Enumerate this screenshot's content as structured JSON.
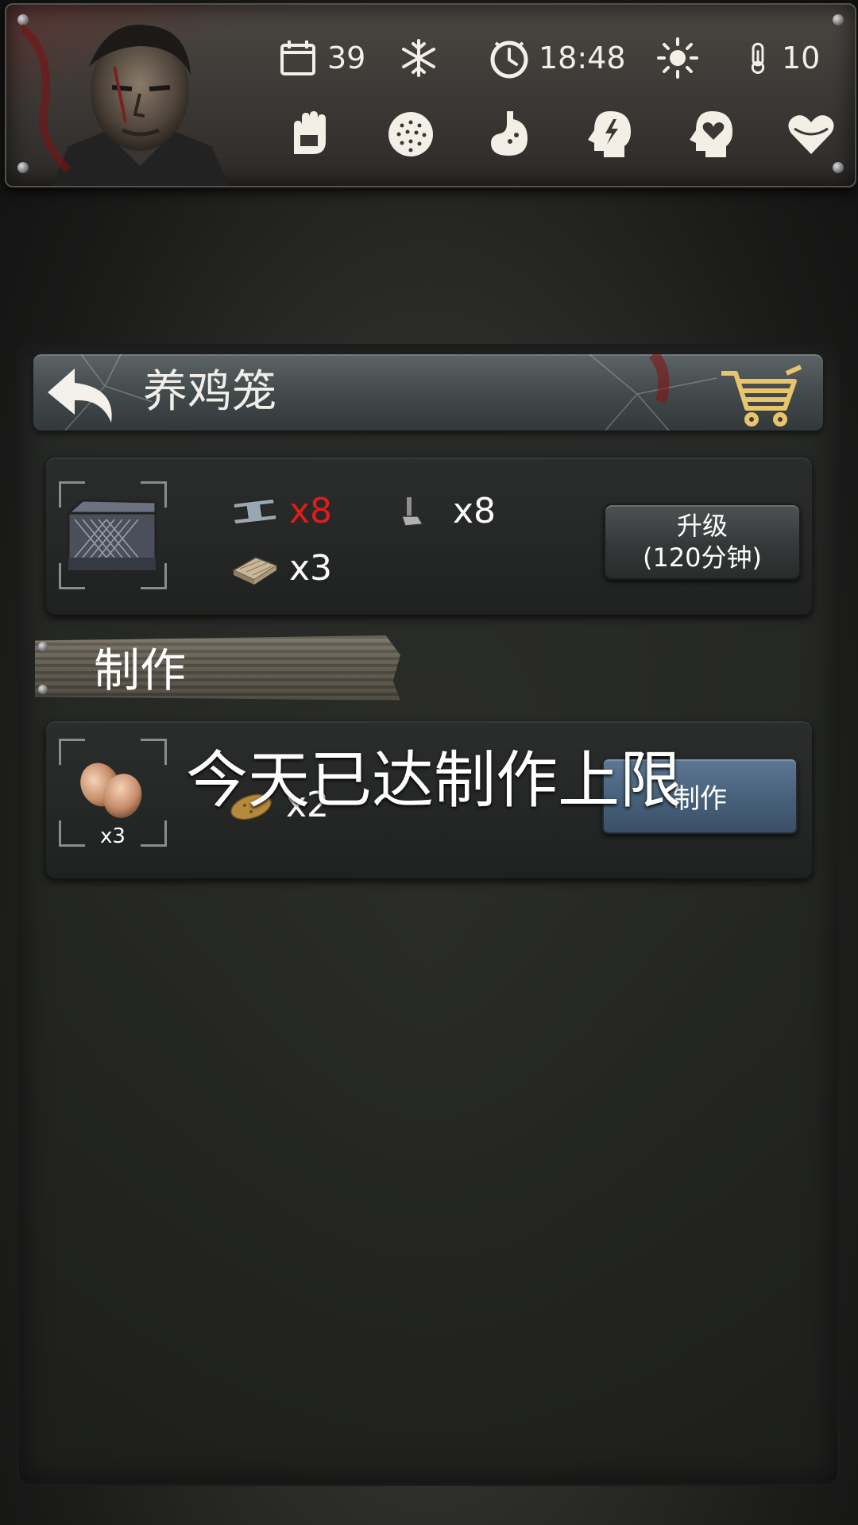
{
  "hud": {
    "day": "39",
    "time": "18:48",
    "temperature": "10",
    "weather_icon": "snowflake-icon",
    "daylight_icon": "sun-icon",
    "conditions": [
      "hands-icon",
      "fatigue-icon",
      "stomach-icon",
      "head-bolt-icon",
      "head-heart-icon",
      "heart-icon"
    ]
  },
  "title_bar": {
    "title": "养鸡笼",
    "back_icon": "back-arrow-icon",
    "shop_icon": "cart-icon"
  },
  "upgrade": {
    "requirements": [
      {
        "icon": "steel-beam-icon",
        "qty": "x8",
        "insufficient": true
      },
      {
        "icon": "bolt-icon",
        "qty": "x8",
        "insufficient": false
      },
      {
        "icon": "planks-icon",
        "qty": "x3",
        "insufficient": false
      }
    ],
    "button_line1": "升级",
    "button_line2": "(120分钟)"
  },
  "craft_section": {
    "label": "制作",
    "limit_message": "今天已达制作上限",
    "output_count": "x3",
    "ingredient_qty": "x2",
    "button_label": "制作"
  },
  "colors": {
    "insufficient": "#e21b1b",
    "craft_button": "#4f6a86"
  }
}
